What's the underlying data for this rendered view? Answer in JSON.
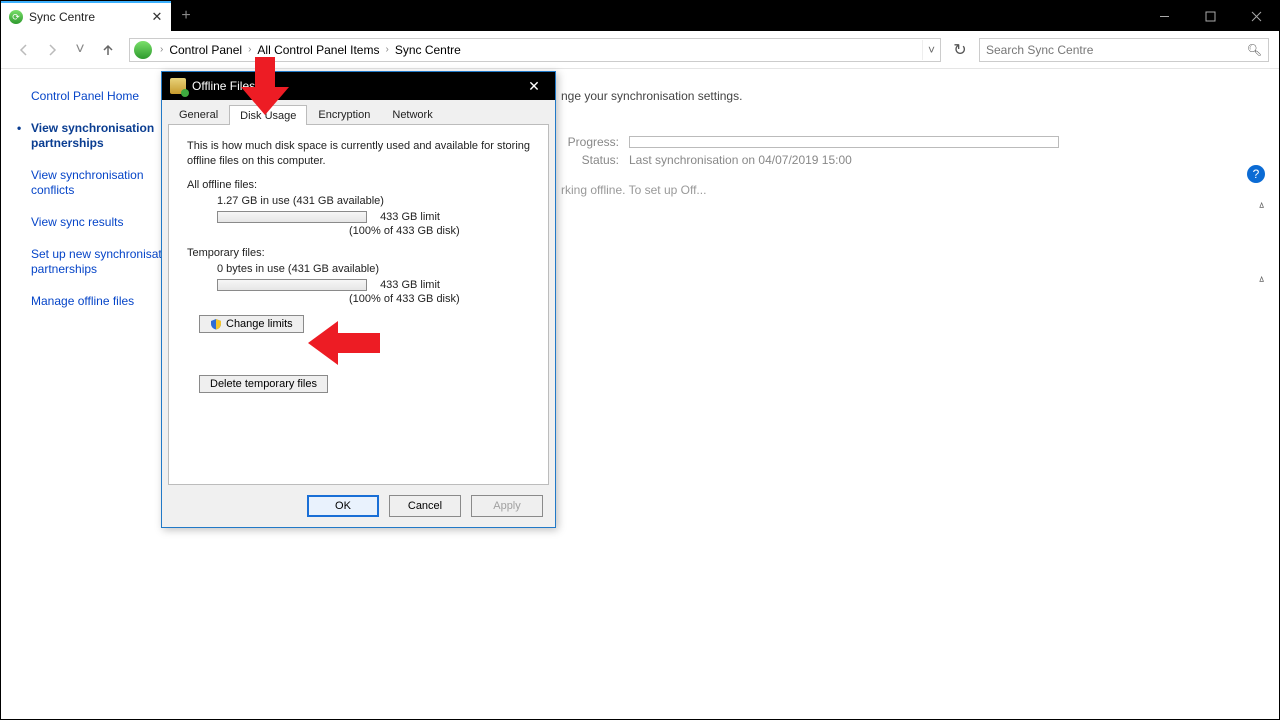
{
  "tab_title": "Sync Centre",
  "breadcrumb": {
    "root": "Control Panel",
    "mid": "All Control Panel Items",
    "leaf": "Sync Centre"
  },
  "search_placeholder": "Search Sync Centre",
  "sidebar": {
    "home": "Control Panel Home",
    "items": [
      "View synchronisation partnerships",
      "View synchronisation conflicts",
      "View sync results",
      "Set up new synchronisation partnerships",
      "Manage offline files"
    ]
  },
  "content": {
    "heading_fragment": "nge your synchronisation settings.",
    "progress_label": "Progress:",
    "status_label": "Status:",
    "status_value": "Last synchronisation on 04/07/2019 15:00",
    "offline_fragment": "rking offline. To set up Off..."
  },
  "dialog": {
    "title": "Offline Files",
    "tabs": [
      "General",
      "Disk Usage",
      "Encryption",
      "Network"
    ],
    "active_tab": 1,
    "desc": "This is how much disk space is currently used and available for storing offline files on this computer.",
    "all_label": "All offline files:",
    "all_usage": "1.27 GB in use (431 GB available)",
    "all_limit": "433 GB limit",
    "all_pct": "(100% of 433 GB disk)",
    "temp_label": "Temporary files:",
    "temp_usage": "0 bytes in use (431 GB available)",
    "temp_limit": "433 GB limit",
    "temp_pct": "(100% of 433 GB disk)",
    "change_limits": "Change limits",
    "delete_temp": "Delete temporary files",
    "ok": "OK",
    "cancel": "Cancel",
    "apply": "Apply"
  }
}
